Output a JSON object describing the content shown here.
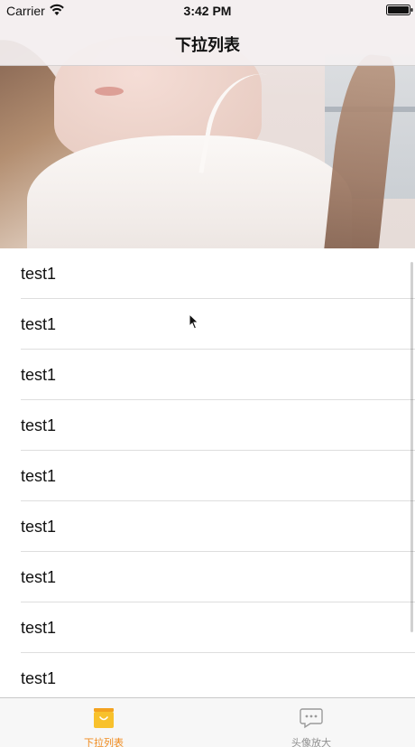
{
  "status_bar": {
    "carrier": "Carrier",
    "time": "3:42 PM"
  },
  "navbar": {
    "title": "下拉列表"
  },
  "header_image": {
    "description_icon": "photo-header"
  },
  "list": {
    "items": [
      {
        "label": "test1"
      },
      {
        "label": "test1"
      },
      {
        "label": "test1"
      },
      {
        "label": "test1"
      },
      {
        "label": "test1"
      },
      {
        "label": "test1"
      },
      {
        "label": "test1"
      },
      {
        "label": "test1"
      },
      {
        "label": "test1"
      }
    ]
  },
  "tabbar": {
    "tabs": [
      {
        "label": "下拉列表",
        "icon": "shopping-bag-icon",
        "selected": true
      },
      {
        "label": "头像放大",
        "icon": "chat-bubble-icon",
        "selected": false
      }
    ]
  },
  "colors": {
    "accent": "#f08b1e",
    "tab_inactive": "#8f8f8f",
    "separator": "#dedede"
  }
}
